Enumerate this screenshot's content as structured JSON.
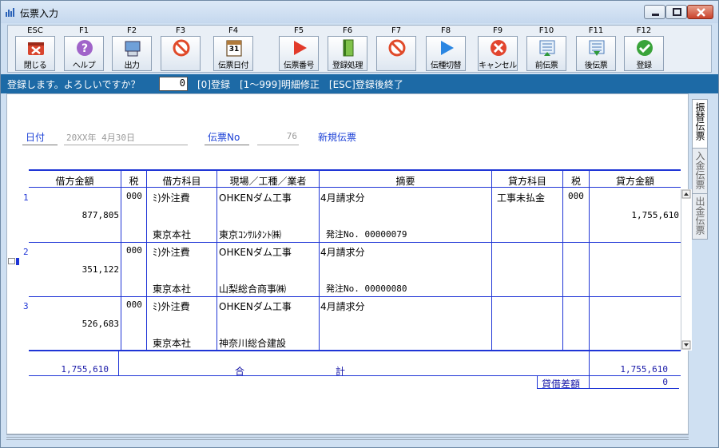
{
  "window": {
    "title": "伝票入力"
  },
  "toolbar": [
    {
      "key": "ESC",
      "label": "閉じる",
      "icon": "close-window-icon"
    },
    {
      "key": "F1",
      "label": "ヘルプ",
      "icon": "help-icon"
    },
    {
      "key": "F2",
      "label": "出力",
      "icon": "output-icon"
    },
    {
      "key": "F3",
      "label": "",
      "icon": "disabled-icon"
    },
    {
      "key": "F4",
      "label": "伝票日付",
      "icon": "calendar-icon",
      "calendar_day": "31"
    },
    {
      "key": "F5",
      "label": "伝票番号",
      "icon": "play-red-icon"
    },
    {
      "key": "F6",
      "label": "登録処理",
      "icon": "book-icon"
    },
    {
      "key": "F7",
      "label": "",
      "icon": "disabled-icon"
    },
    {
      "key": "F8",
      "label": "伝種切替",
      "icon": "play-blue-icon"
    },
    {
      "key": "F9",
      "label": "キャンセル",
      "icon": "cancel-icon"
    },
    {
      "key": "F10",
      "label": "前伝票",
      "icon": "prev-icon"
    },
    {
      "key": "F11",
      "label": "後伝票",
      "icon": "next-icon"
    },
    {
      "key": "F12",
      "label": "登録",
      "icon": "check-icon"
    }
  ],
  "status": {
    "message": "登録します。よろしいですか？",
    "input_value": "0",
    "help": "[0]登録　[1〜999]明細修正　[ESC]登録後終了"
  },
  "header": {
    "date_label": "日付",
    "date_value": "20XX年 4月30日",
    "slip_no_label": "伝票No",
    "slip_no_value": "76",
    "new_slip": "新規伝票"
  },
  "columns": [
    "借方金額",
    "税",
    "借方科目",
    "現場／工種／業者",
    "摘要",
    "貸方科目",
    "税",
    "貸方金額"
  ],
  "rows": [
    {
      "no": "1",
      "debit_amount": "877,805",
      "tax": "000",
      "debit_account": "ﾐ)外注費",
      "branch": "東京本社",
      "site": "OHKENダム工事",
      "vendor": "東京ｺﾝｻﾙﾀﾝﾄ㈱",
      "memo": "4月請求分",
      "order": "発注No. 00000079",
      "credit_account": "工事未払金",
      "credit_tax": "000",
      "credit_amount": "1,755,610"
    },
    {
      "no": "2",
      "debit_amount": "351,122",
      "tax": "000",
      "debit_account": "ﾐ)外注費",
      "branch": "東京本社",
      "site": "OHKENダム工事",
      "vendor": "山梨総合商事㈱",
      "memo": "4月請求分",
      "order": "発注No. 00000080",
      "credit_account": "",
      "credit_tax": "",
      "credit_amount": ""
    },
    {
      "no": "3",
      "debit_amount": "526,683",
      "tax": "000",
      "debit_account": "ﾐ)外注費",
      "branch": "東京本社",
      "site": "OHKENダム工事",
      "vendor": "神奈川総合建設",
      "memo": "4月請求分",
      "order": "",
      "credit_account": "",
      "credit_tax": "",
      "credit_amount": ""
    }
  ],
  "totals": {
    "debit_total": "1,755,610",
    "label_a": "合",
    "label_b": "計",
    "credit_total": "1,755,610",
    "diff_label": "貸借差額",
    "diff_value": "0"
  },
  "side_tabs": [
    "振替伝票",
    "入金伝票",
    "出金伝票"
  ],
  "colors": {
    "accent": "#1d6aa6",
    "grid": "#1f35d6"
  }
}
